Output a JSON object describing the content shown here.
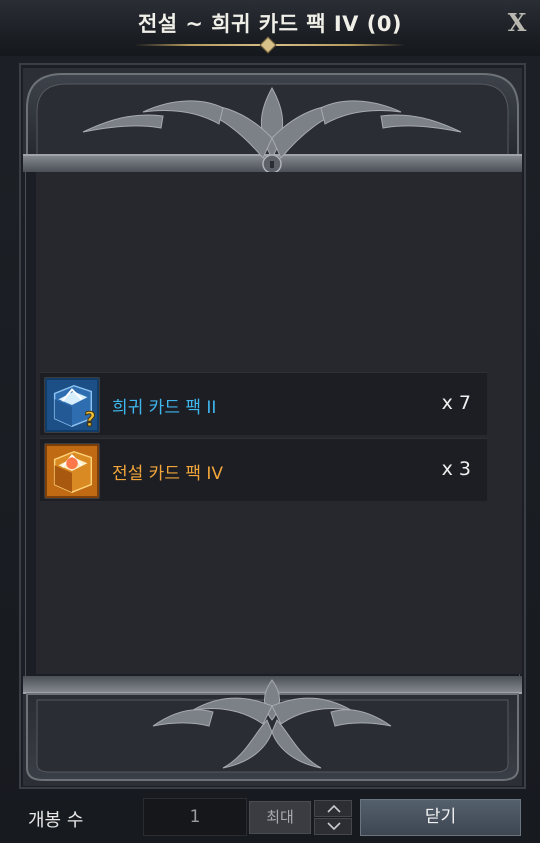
{
  "window": {
    "title": "전설 ~ 희귀 카드 팩 IV (0)",
    "close_glyph": "X"
  },
  "items": [
    {
      "name": "희귀 카드 팩 II",
      "quantity": "x 7",
      "name_color": "#3fb6ee",
      "icon": "rare-card-pack-icon"
    },
    {
      "name": "전설 카드 팩 IV",
      "quantity": "x 3",
      "name_color": "#f1a53a",
      "icon": "legendary-card-pack-icon"
    }
  ],
  "controls": {
    "open_count_label": "개봉 수",
    "open_count_value": "1",
    "max_label": "최대",
    "close_label": "닫기"
  }
}
